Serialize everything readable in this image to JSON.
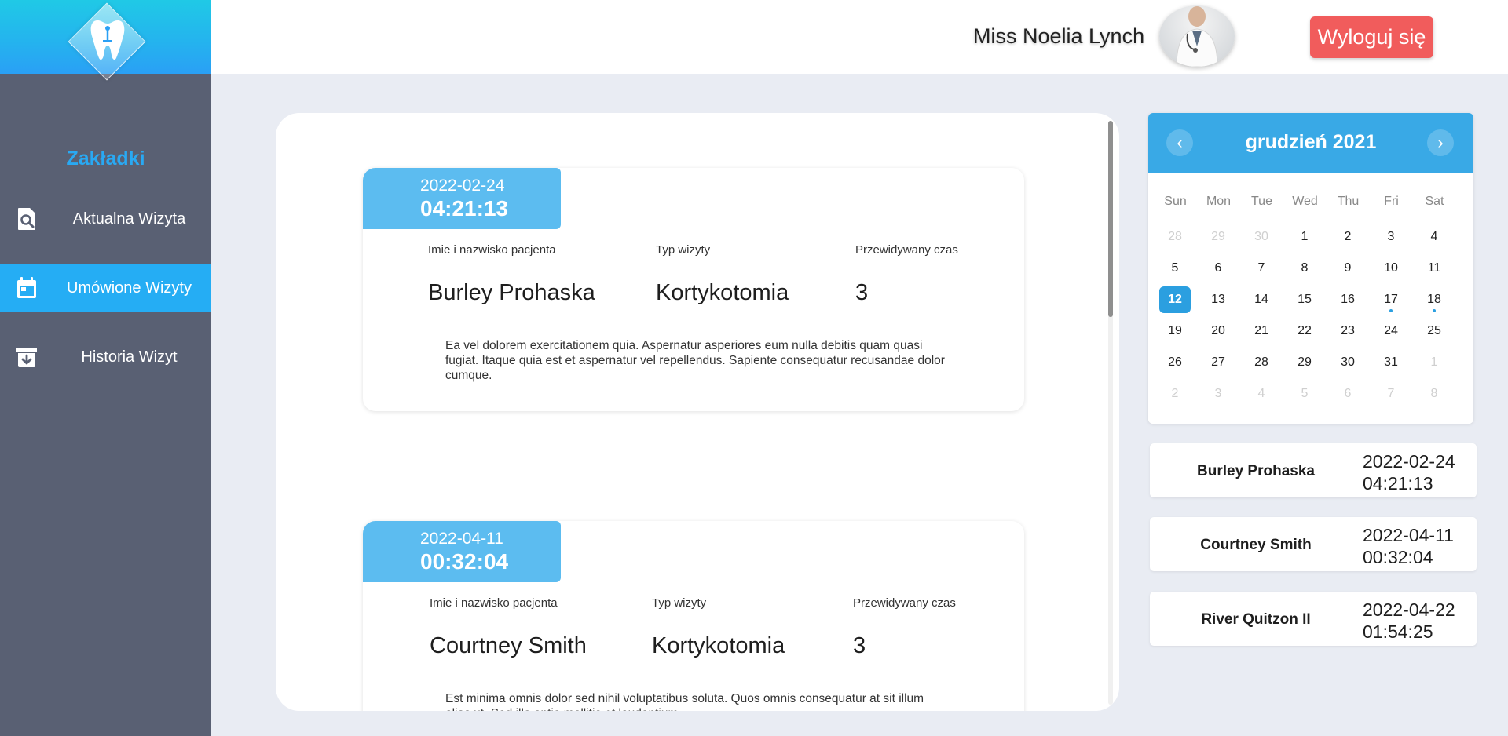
{
  "sidebar": {
    "title": "Zakładki",
    "items": [
      {
        "label": "Aktualna Wizyta",
        "icon": "search-document-icon"
      },
      {
        "label": "Umówione Wizyty",
        "icon": "calendar-icon",
        "active": true
      },
      {
        "label": "Historia Wizyt",
        "icon": "archive-icon"
      }
    ]
  },
  "header": {
    "user_name": "Miss Noelia Lynch",
    "logout_label": "Wyloguj się"
  },
  "visits": [
    {
      "date": "2022-02-24",
      "time": "04:21:13",
      "patient_label": "Imie i nazwisko pacjenta",
      "type_label": "Typ wizyty",
      "duration_label": "Przewidywany czas",
      "patient": "Burley Prohaska",
      "type": "Kortykotomia",
      "duration": "3",
      "description": "Ea vel dolorem exercitationem quia. Aspernatur asperiores eum nulla debitis quam quasi fugiat. Itaque quia est et aspernatur vel repellendus. Sapiente consequatur recusandae dolor cumque."
    },
    {
      "date": "2022-04-11",
      "time": "00:32:04",
      "patient_label": "Imie i nazwisko pacjenta",
      "type_label": "Typ wizyty",
      "duration_label": "Przewidywany czas",
      "patient": "Courtney Smith",
      "type": "Kortykotomia",
      "duration": "3",
      "description": "Est minima omnis dolor sed nihil voluptatibus soluta. Quos omnis consequatur at sit illum alias ut. Sed illo optio mollitia et laudantium."
    }
  ],
  "calendar": {
    "title": "grudzień 2021",
    "weekdays": [
      "Sun",
      "Mon",
      "Tue",
      "Wed",
      "Thu",
      "Fri",
      "Sat"
    ],
    "weeks": [
      [
        {
          "d": "28",
          "m": true
        },
        {
          "d": "29",
          "m": true
        },
        {
          "d": "30",
          "m": true
        },
        {
          "d": "1"
        },
        {
          "d": "2"
        },
        {
          "d": "3"
        },
        {
          "d": "4"
        }
      ],
      [
        {
          "d": "5"
        },
        {
          "d": "6"
        },
        {
          "d": "7"
        },
        {
          "d": "8"
        },
        {
          "d": "9"
        },
        {
          "d": "10"
        },
        {
          "d": "11"
        }
      ],
      [
        {
          "d": "12",
          "today": true
        },
        {
          "d": "13"
        },
        {
          "d": "14"
        },
        {
          "d": "15"
        },
        {
          "d": "16"
        },
        {
          "d": "17",
          "dot": true
        },
        {
          "d": "18",
          "dot": true
        }
      ],
      [
        {
          "d": "19"
        },
        {
          "d": "20"
        },
        {
          "d": "21"
        },
        {
          "d": "22"
        },
        {
          "d": "23"
        },
        {
          "d": "24"
        },
        {
          "d": "25"
        }
      ],
      [
        {
          "d": "26"
        },
        {
          "d": "27"
        },
        {
          "d": "28"
        },
        {
          "d": "29"
        },
        {
          "d": "30"
        },
        {
          "d": "31"
        },
        {
          "d": "1",
          "m": true
        }
      ],
      [
        {
          "d": "2",
          "m": true
        },
        {
          "d": "3",
          "m": true
        },
        {
          "d": "4",
          "m": true
        },
        {
          "d": "5",
          "m": true
        },
        {
          "d": "6",
          "m": true
        },
        {
          "d": "7",
          "m": true
        },
        {
          "d": "8",
          "m": true
        }
      ]
    ]
  },
  "upcoming": [
    {
      "name": "Burley Prohaska",
      "date": "2022-02-24",
      "time": "04:21:13"
    },
    {
      "name": "Courtney Smith",
      "date": "2022-04-11",
      "time": "00:32:04"
    },
    {
      "name": "River Quitzon II",
      "date": "2022-04-22",
      "time": "01:54:25"
    }
  ],
  "colors": {
    "sidebar_bg": "#596073",
    "accent": "#25adf4",
    "logout": "#f15c5c",
    "date_tab": "#5cbcf0",
    "calendar_header": "#39a9e6"
  }
}
